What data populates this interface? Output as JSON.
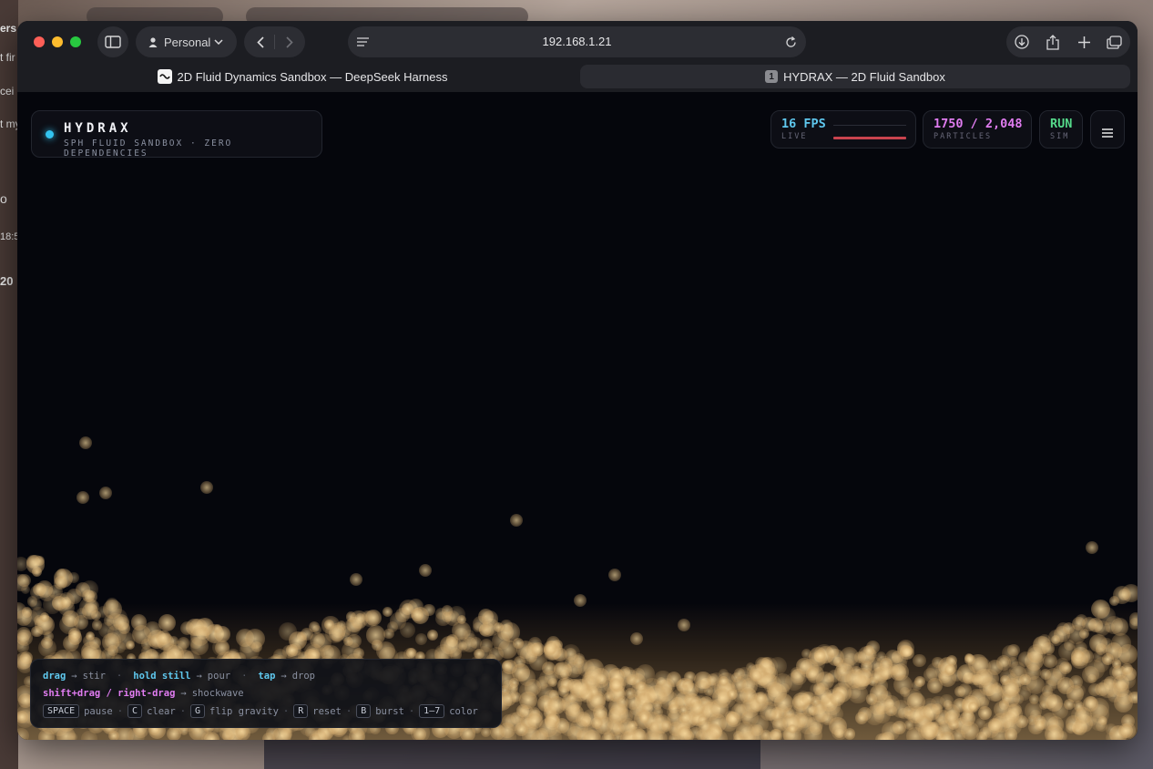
{
  "desktop": {
    "left_snippets": [
      "ers",
      "t fir",
      "cei",
      "t my",
      "o",
      "18:5",
      "20"
    ]
  },
  "browser": {
    "profile_label": "Personal",
    "url": "192.168.1.21",
    "tabs": [
      {
        "title": "2D Fluid Dynamics Sandbox — DeepSeek Harness",
        "active": false
      },
      {
        "title": "HYDRAX — 2D Fluid Sandbox",
        "badge": "1",
        "active": true
      }
    ]
  },
  "app": {
    "brand": {
      "title": "HYDRAX",
      "subtitle": "SPH FLUID SANDBOX · ZERO DEPENDENCIES",
      "dot_color": "#33c4f0"
    },
    "stats": {
      "fps": {
        "value": "16 FPS",
        "label": "LIVE",
        "color": "#5fc8ee"
      },
      "particles": {
        "value": "1750 / 2,048",
        "label": "PARTICLES",
        "color": "#e07cf0"
      },
      "sim": {
        "value": "RUN",
        "label": "SIM",
        "color": "#55d98a"
      }
    },
    "menu_icon": "hamburger-menu-icon",
    "help": {
      "row1": [
        {
          "key": "drag",
          "action": "stir"
        },
        {
          "key": "hold still",
          "action": "pour"
        },
        {
          "key": "tap",
          "action": "drop"
        }
      ],
      "row2": {
        "key": "shift+drag / right-drag",
        "action": "shockwave"
      },
      "row3": [
        {
          "key": "SPACE",
          "action": "pause"
        },
        {
          "key": "C",
          "action": "clear"
        },
        {
          "key": "G",
          "action": "flip gravity"
        },
        {
          "key": "R",
          "action": "reset"
        },
        {
          "key": "B",
          "action": "burst"
        },
        {
          "key": "1–7",
          "action": "color"
        }
      ],
      "arrow": "→",
      "separator": "·"
    },
    "fluid_color": "#e8c58a"
  }
}
